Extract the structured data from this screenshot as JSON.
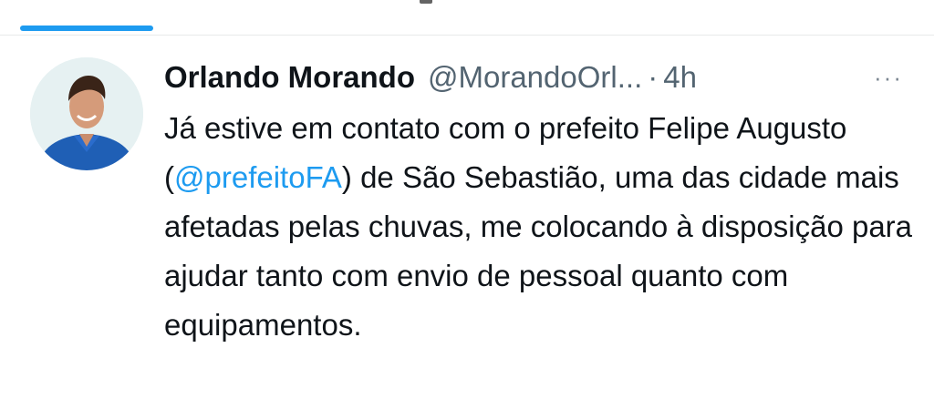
{
  "tweet": {
    "author_name": "Orlando Morando",
    "handle": "@MorandoOrl...",
    "separator": "·",
    "time": "4h",
    "more_label": "···",
    "text_part1": "Já estive em contato com o prefeito Felipe Augusto (",
    "mention": "@prefeitoFA",
    "text_part2": ") de São Sebastião, uma das cidade mais afetadas pelas chuvas, me colocando à disposição para ajudar tanto com envio de pessoal quanto com equipamentos."
  },
  "colors": {
    "accent": "#1d9bf0",
    "text_primary": "#0f1419",
    "text_secondary": "#536471",
    "divider": "#e7e9ea"
  },
  "icons": {
    "more": "more-dots-icon",
    "avatar": "profile-photo"
  }
}
